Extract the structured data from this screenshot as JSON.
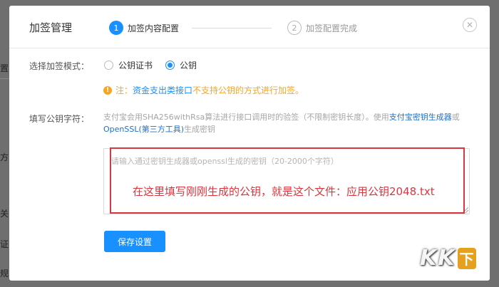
{
  "background": {
    "fragments": [
      "置",
      "方",
      "关",
      "证",
      "规"
    ]
  },
  "dialog": {
    "title": "加签管理",
    "close_icon": "close-circle-icon",
    "steps": [
      {
        "number": "1",
        "label": "加签内容配置",
        "state": "active"
      },
      {
        "number": "2",
        "label": "加签配置完成",
        "state": "inactive"
      }
    ],
    "mode": {
      "label": "选择加签模式：",
      "options": [
        {
          "label": "公钥证书",
          "checked": false
        },
        {
          "label": "公钥",
          "checked": true
        }
      ]
    },
    "warning": {
      "icon": "exclamation-icon",
      "prefix": "注：",
      "link": "资金支出类接口",
      "suffix": "不支持公钥的方式进行加签。"
    },
    "key": {
      "label": "填写公钥字符：",
      "desc_text": "支付宝会用SHA256withRsa算法进行接口调用时的验签（不限制密钥长度）。使用",
      "desc_link1": "支付宝密钥生成器",
      "desc_or": "或",
      "desc_link2": "OpenSSL(第三方工具)",
      "desc_end": "生成密钥",
      "placeholder": "请输入通过密钥生成器或openssl生成的密钥（20-2000个字符）",
      "annotation": "在这里填写刚刚生成的公钥，就是这个文件：应用公钥2048.txt"
    },
    "save_label": "保存设置"
  },
  "watermark": {
    "letters": [
      "K",
      "K"
    ],
    "badge": "下"
  },
  "colors": {
    "primary": "#1890ff",
    "warning": "#f5a623",
    "annotation": "#d9373f",
    "overlay": "#6f6f6f"
  }
}
